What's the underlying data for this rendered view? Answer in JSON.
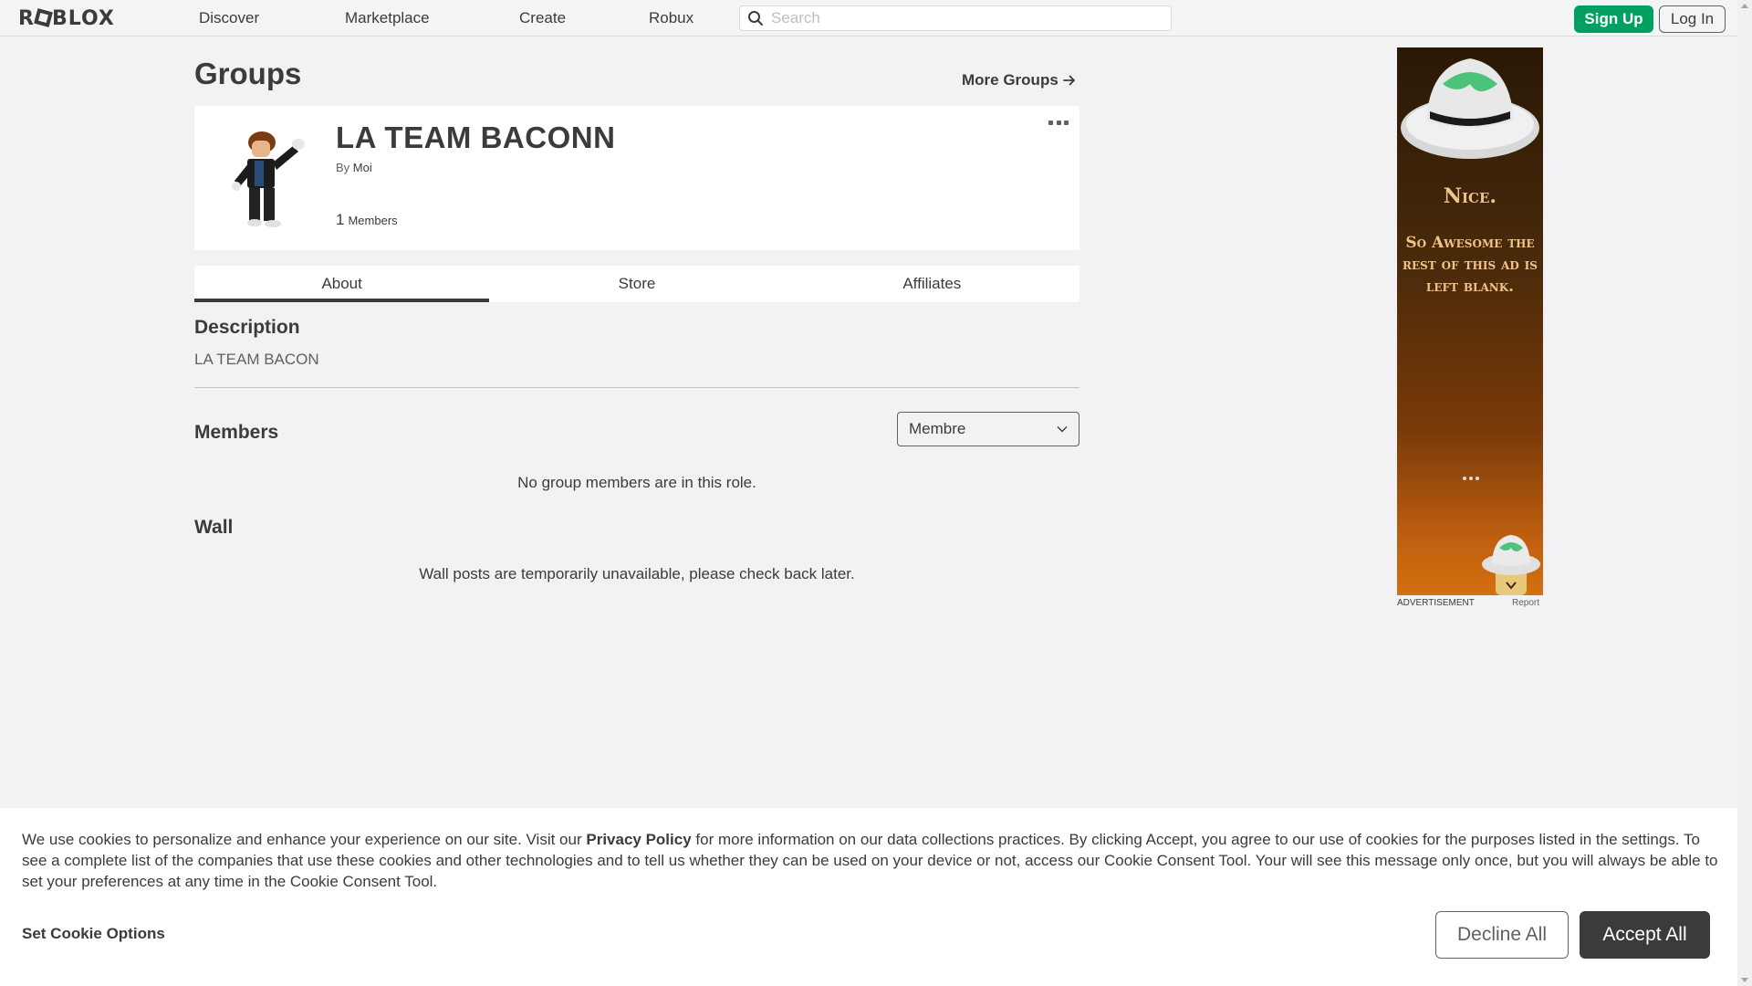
{
  "nav": {
    "logo": "ROBLOX",
    "links": [
      "Discover",
      "Marketplace",
      "Create",
      "Robux"
    ],
    "search_placeholder": "Search",
    "signup_label": "Sign Up",
    "login_label": "Log In"
  },
  "page": {
    "title": "Groups",
    "more_groups": "More Groups"
  },
  "group": {
    "name": "LA TEAM BACONN",
    "by_prefix": "By",
    "owner": "Moi",
    "member_count": "1",
    "members_label": "Members"
  },
  "tabs": [
    "About",
    "Store",
    "Affiliates"
  ],
  "about": {
    "description_heading": "Description",
    "description_text": "LA TEAM BACON",
    "members_heading": "Members",
    "role_selected": "Membre",
    "members_empty": "No group members are in this role.",
    "wall_heading": "Wall",
    "wall_empty": "Wall posts are temporarily unavailable, please check back later."
  },
  "ad": {
    "headline": "Nice.",
    "body": "So Awesome the rest of this ad is left blank.",
    "label": "ADVERTISEMENT",
    "report": "Report"
  },
  "cookie": {
    "text_before": "We use cookies to personalize and enhance your experience on our site. Visit our ",
    "policy_link": "Privacy Policy",
    "text_after": " for more information on our data collections practices. By clicking Accept, you agree to our use of cookies for the purposes listed in the settings. To see a complete list of the companies that use these cookies and other technologies and to tell us whether they can be used on your device or not, access our Cookie Consent Tool. Your will see this message only once, but you will always be able to set your preferences at any time in the Cookie Consent Tool.",
    "options_label": "Set Cookie Options",
    "decline_label": "Decline All",
    "accept_label": "Accept All"
  },
  "colors": {
    "signup_green": "#00a060",
    "accept_dark": "#393b3d",
    "page_bg": "#f2f2f4"
  }
}
